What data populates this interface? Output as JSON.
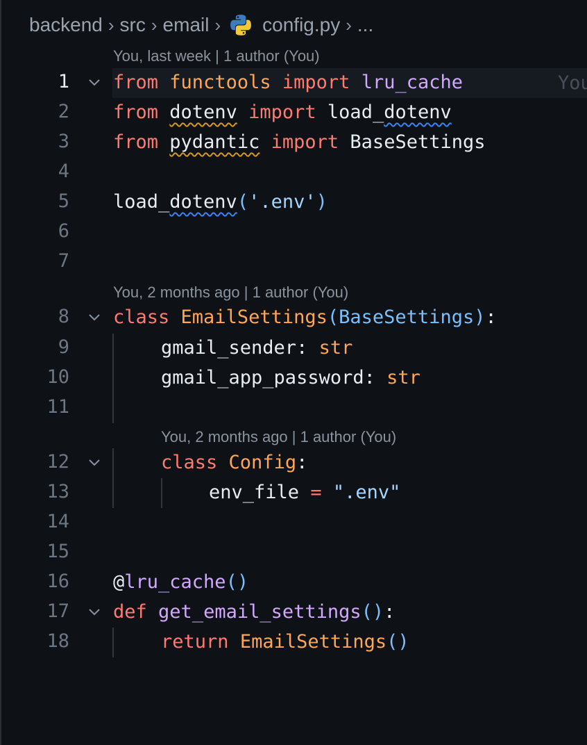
{
  "breadcrumb": {
    "items": [
      "backend",
      "src",
      "email"
    ],
    "file": "config.py",
    "more": "..."
  },
  "blame": {
    "block1": "You, last week | 1 author (You)",
    "block2": "You, 2 months ago | 1 author (You)",
    "block3": "You, 2 months ago | 1 author (You)",
    "inline": "You"
  },
  "lines": {
    "l1": {
      "num": "1",
      "t1": "from",
      "t2": " ",
      "t3": "functools",
      "t4": " ",
      "t5": "import",
      "t6": " ",
      "t7": "lru_cache"
    },
    "l2": {
      "num": "2",
      "t1": "from",
      "t2": " ",
      "t3": "dotenv",
      "t4": " ",
      "t5": "import",
      "t6": " ",
      "t7a": "load_",
      "t7b": "dotenv"
    },
    "l3": {
      "num": "3",
      "t1": "from",
      "t2": " ",
      "t3": "pydantic",
      "t4": " ",
      "t5": "import",
      "t6": " ",
      "t7": "BaseSettings"
    },
    "l4": {
      "num": "4"
    },
    "l5": {
      "num": "5",
      "t1": "load_",
      "t2": "dotenv",
      "t3": "(",
      "t4": "'.env'",
      "t5": ")"
    },
    "l6": {
      "num": "6"
    },
    "l7": {
      "num": "7"
    },
    "l8": {
      "num": "8",
      "t1": "class",
      "t2": " ",
      "t3": "EmailSettings",
      "t4": "(",
      "t5": "BaseSettings",
      "t6": ")",
      "t7": ":"
    },
    "l9": {
      "num": "9",
      "t1": "gmail_sender",
      "t2": ": ",
      "t3": "str"
    },
    "l10": {
      "num": "10",
      "t1": "gmail_app_password",
      "t2": ": ",
      "t3": "str"
    },
    "l11": {
      "num": "11"
    },
    "l12": {
      "num": "12",
      "t1": "class",
      "t2": " ",
      "t3": "Config",
      "t4": ":"
    },
    "l13": {
      "num": "13",
      "t1": "env_file",
      "t2": " ",
      "t3": "=",
      "t4": " ",
      "t5": "\".env\""
    },
    "l14": {
      "num": "14"
    },
    "l15": {
      "num": "15"
    },
    "l16": {
      "num": "16",
      "t1": "@",
      "t2": "lru_cache",
      "t3": "()"
    },
    "l17": {
      "num": "17",
      "t1": "def",
      "t2": " ",
      "t3": "get_email_settings",
      "t4": "()",
      "t5": ":"
    },
    "l18": {
      "num": "18",
      "t1": "return",
      "t2": " ",
      "t3": "EmailSettings",
      "t4": "()"
    }
  },
  "colors": {
    "keyword": "#ff7b72",
    "module": "#ffa657",
    "function": "#d2a8ff",
    "string": "#a5d6ff",
    "bracket": "#79c0ff",
    "background": "#0e1116"
  },
  "icons": {
    "file_icon": "python-icon",
    "fold_icon": "chevron-down-icon"
  }
}
